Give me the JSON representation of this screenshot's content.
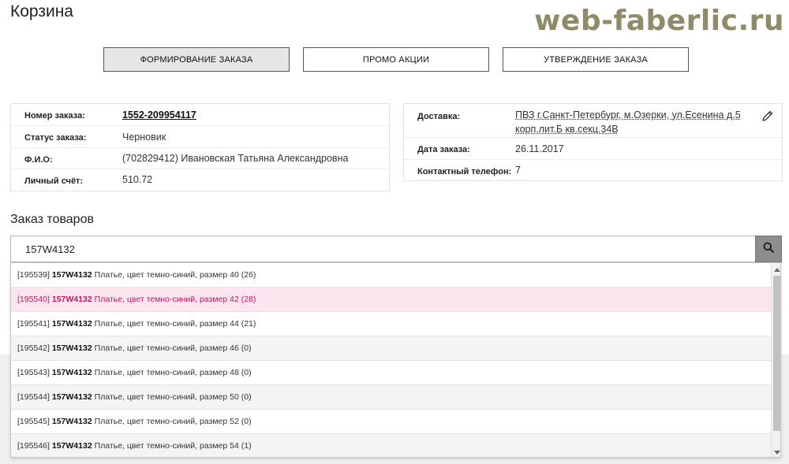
{
  "page_title": "Корзина",
  "watermark": "web-faberlic.ru",
  "steps": [
    {
      "label": "ФОРМИРОВАНИЕ ЗАКАЗА",
      "active": true
    },
    {
      "label": "ПРОМО АКЦИИ",
      "active": false
    },
    {
      "label": "УТВЕРЖДЕНИЕ ЗАКАЗА",
      "active": false
    }
  ],
  "order_info": {
    "number_label": "Номер заказа:",
    "number_value": "1552-209954117",
    "status_label": "Статус заказа:",
    "status_value": "Черновик",
    "fio_label": "Ф.И.О:",
    "fio_value": "(702829412) Ивановская Татьяна Александровна",
    "account_label": "Личный счёт:",
    "account_value": "510.72"
  },
  "delivery_info": {
    "delivery_label": "Доставка:",
    "delivery_line1": "ПВЗ г.Санкт-Петербург, м.Озерки, ул.Есенина д.5",
    "delivery_line2": "корп.лит.Б кв.секц.34В",
    "date_label": "Дата заказа:",
    "date_value": "26.11.2017",
    "phone_label": "Контактный телефон:",
    "phone_value": "7",
    "edit_icon": "pencil-icon"
  },
  "order_products": {
    "title": "Заказ товаров",
    "search_value": "157W4132",
    "search_icon": "search-icon"
  },
  "suggestions": [
    {
      "code": "[195539]",
      "sku": "157W4132",
      "desc": "Платье, цвет темно-синий, размер 40 (26)"
    },
    {
      "code": "[195540]",
      "sku": "157W4132",
      "desc": "Платье, цвет темно-синий, размер 42 (28)"
    },
    {
      "code": "[195541]",
      "sku": "157W4132",
      "desc": "Платье, цвет темно-синий, размер 44 (21)"
    },
    {
      "code": "[195542]",
      "sku": "157W4132",
      "desc": "Платье, цвет темно-синий, размер 46 (0)"
    },
    {
      "code": "[195543]",
      "sku": "157W4132",
      "desc": "Платье, цвет темно-синий, размер 48 (0)"
    },
    {
      "code": "[195544]",
      "sku": "157W4132",
      "desc": "Платье, цвет темно-синий, размер 50 (0)"
    },
    {
      "code": "[195545]",
      "sku": "157W4132",
      "desc": "Платье, цвет темно-синий, размер 52 (0)"
    },
    {
      "code": "[195546]",
      "sku": "157W4132",
      "desc": "Платье, цвет темно-синий, размер 54 (1)"
    }
  ],
  "colors": {
    "highlight_bg": "#fbe6ef",
    "highlight_text": "#c0185a",
    "search_button": "#8d8d8d",
    "watermark": "#8a8460"
  }
}
